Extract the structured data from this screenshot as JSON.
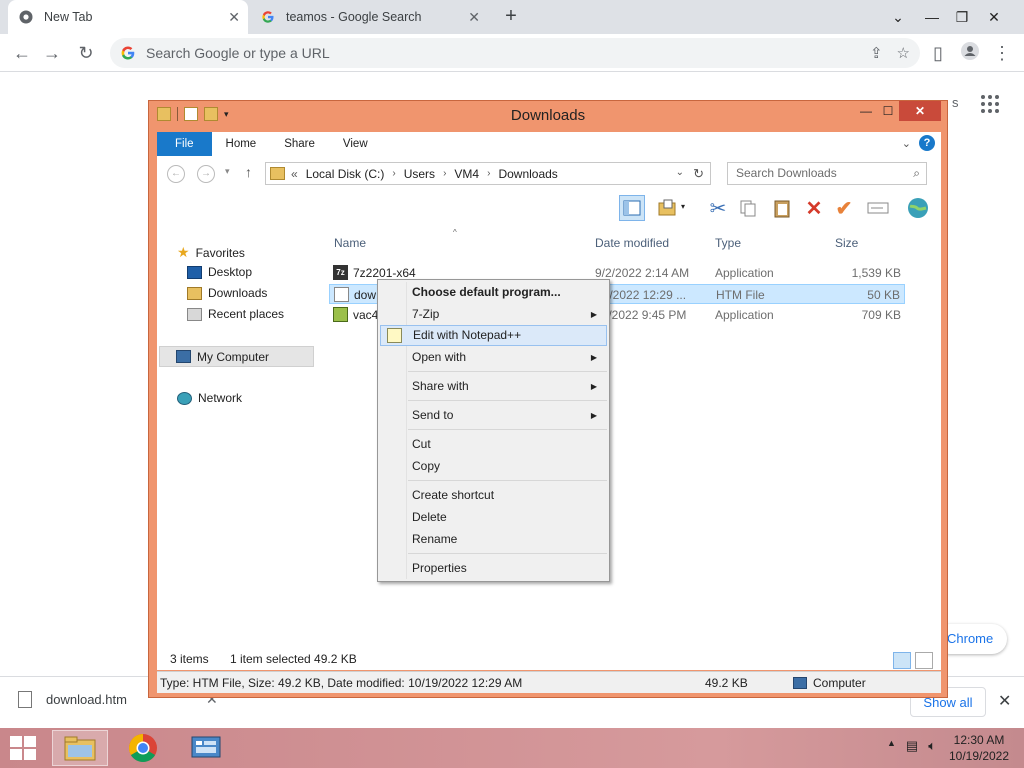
{
  "browser": {
    "tabs": [
      {
        "title": "New Tab",
        "active": true
      },
      {
        "title": "teamos - Google Search",
        "active": false
      }
    ],
    "new_tab_label": "+",
    "omnibox_placeholder": "Search Google or type a URL",
    "page_partial_text": "s",
    "chrome_pill_label": "Chrome",
    "download_bar": {
      "filename": "download.htm",
      "show_all_label": "Show all"
    }
  },
  "explorer": {
    "title": "Downloads",
    "ribbon_tabs": [
      "File",
      "Home",
      "Share",
      "View"
    ],
    "breadcrumb": [
      "Local Disk (C:)",
      "Users",
      "VM4",
      "Downloads"
    ],
    "breadcrumb_prefix": "«",
    "search_placeholder": "Search Downloads",
    "nav": {
      "favorites": "Favorites",
      "desktop": "Desktop",
      "downloads": "Downloads",
      "recent": "Recent places",
      "my_computer": "My Computer",
      "network": "Network"
    },
    "columns": {
      "name": "Name",
      "date": "Date modified",
      "type": "Type",
      "size": "Size"
    },
    "files": [
      {
        "name": "7z2201-x64",
        "date": "9/2/2022 2:14 AM",
        "type": "Application",
        "size": "1,539 KB"
      },
      {
        "name": "dow",
        "date": "19/2022 12:29 ...",
        "type": "HTM File",
        "size": "50 KB"
      },
      {
        "name": "vac4",
        "date": "17/2022 9:45 PM",
        "type": "Application",
        "size": "709 KB"
      }
    ],
    "status": {
      "items": "3 items",
      "selected": "1 item selected  49.2 KB",
      "detail": "Type: HTM File, Size: 49.2 KB, Date modified: 10/19/2022 12:29 AM",
      "size": "49.2 KB",
      "location": "Computer"
    }
  },
  "context_menu": {
    "choose_default": "Choose default program...",
    "seven_zip": "7-Zip",
    "edit_notepad": "Edit with Notepad++",
    "open_with": "Open with",
    "share_with": "Share with",
    "send_to": "Send to",
    "cut": "Cut",
    "copy": "Copy",
    "create_shortcut": "Create shortcut",
    "delete": "Delete",
    "rename": "Rename",
    "properties": "Properties"
  },
  "taskbar": {
    "time": "12:30 AM",
    "date": "10/19/2022"
  },
  "colors": {
    "explorer_frame": "#f0956e",
    "ribbon_file": "#1979ca",
    "taskbar": "#d69a9c",
    "selection": "#cce8ff"
  }
}
